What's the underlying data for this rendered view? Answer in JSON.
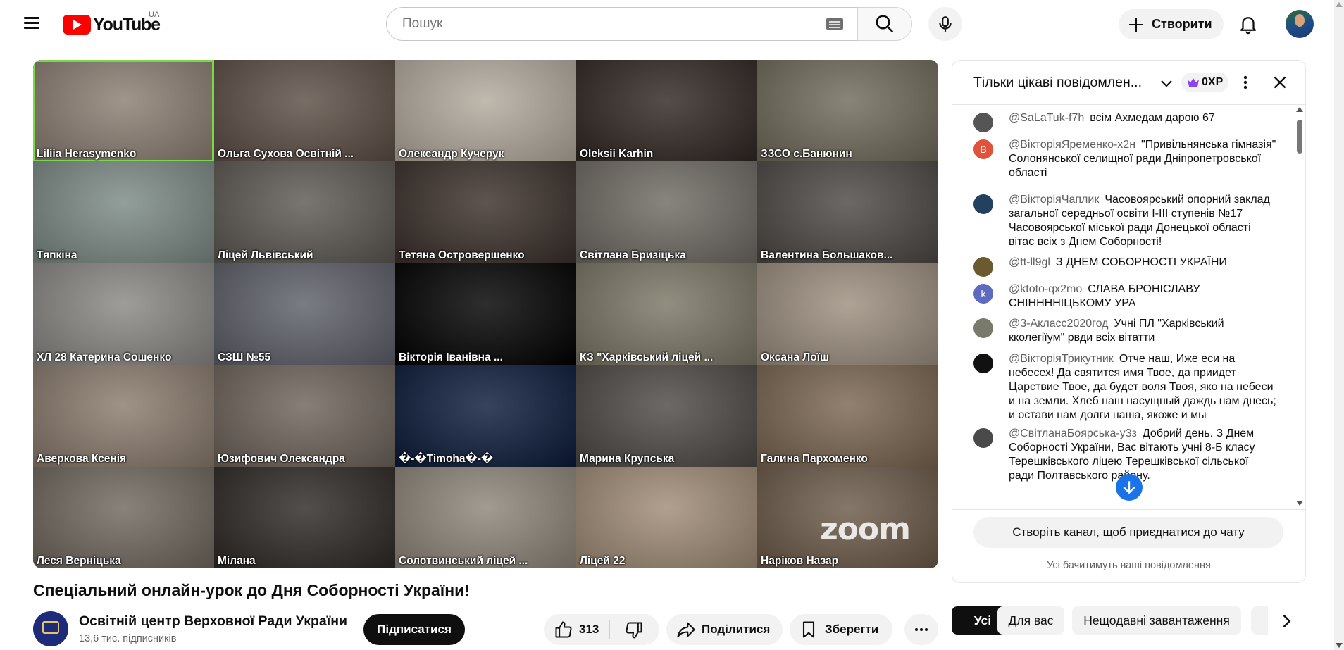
{
  "header": {
    "logo_text": "YouTube",
    "country_code": "UA",
    "search_placeholder": "Пошук",
    "create_label": "Створити"
  },
  "video": {
    "participants": [
      {
        "name": "Liliia Herasymenko",
        "bg": "#8b7e72",
        "active": true
      },
      {
        "name": "Ольга Сухова Освітній ...",
        "bg": "#5b4e45"
      },
      {
        "name": "Олександр Кучерук",
        "bg": "#b3aa9d"
      },
      {
        "name": "Oleksii Karhin",
        "bg": "#2f2622"
      },
      {
        "name": "ЗЗСО с.Банюнин",
        "bg": "#6f6a5a"
      },
      {
        "name": "Тяпкіна",
        "bg": "#7c8a86"
      },
      {
        "name": "Ліцей Львівський",
        "bg": "#5c5752"
      },
      {
        "name": "Тетяна Островершенко",
        "bg": "#3a2f2a"
      },
      {
        "name": "Світлана Бризіцька",
        "bg": "#6e6a63"
      },
      {
        "name": "Валентина Большаков...",
        "bg": "#4c4744"
      },
      {
        "name": "ХЛ 28 Катерина Сошенко",
        "bg": "#8a8784"
      },
      {
        "name": "СЗШ №55",
        "bg": "#5d5f68"
      },
      {
        "name": "Вікторія Іванівна ...",
        "bg": "#000000"
      },
      {
        "name": "КЗ \"Харківський ліцей ...",
        "bg": "#7a7564"
      },
      {
        "name": "Оксана Лоїш",
        "bg": "#9c8e7e"
      },
      {
        "name": "Аверкова Ксенія",
        "bg": "#8a7b6d"
      },
      {
        "name": "Юзифович Олександра",
        "bg": "#6d625a"
      },
      {
        "name": "�-�Timoha�-�",
        "bg": "#0b1a3a"
      },
      {
        "name": "Марина Крупська",
        "bg": "#4d4845"
      },
      {
        "name": "Галина Пархоменко",
        "bg": "#7a6550"
      },
      {
        "name": "Леся Верніцька",
        "bg": "#6f675e"
      },
      {
        "name": "Мілана",
        "bg": "#2d2824"
      },
      {
        "name": "Солотвинський ліцей ...",
        "bg": "#8e857a"
      },
      {
        "name": "Ліцей 22",
        "bg": "#a08b76"
      },
      {
        "name": "Наріков Назар",
        "bg": "#6b5a48"
      }
    ],
    "watermark": "zoom",
    "title": "Спеціальний онлайн-урок до Дня Соборності України!",
    "channel_name": "Освітній центр Верховної Ради України",
    "subscribers": "13,6 тис. підписників",
    "subscribe_label": "Підписатися",
    "like_count": "313",
    "share_label": "Поділитися",
    "save_label": "Зберегти"
  },
  "chat": {
    "title": "Тільки цікаві повідомлен...",
    "xp_label": "0XP",
    "accent_purple": "#8e44ec",
    "messages": [
      {
        "author": "@SaLaTuk-f7h",
        "text": "всім Ахмедам дарою 67",
        "avatar_color": "#555555",
        "avatar_letter": ""
      },
      {
        "author": "@ВікторіяЯременко-х2н",
        "text": "\"Привільнянська гімназія\" Солонянської селищної ради Дніпропетровської області",
        "avatar_color": "#e2523a",
        "avatar_letter": "В"
      },
      {
        "author": "@ВікторіяЧаплик",
        "text": "Часовоярський опорний заклад загальної середньої освіти І-ІІІ ступенів №17 Часовоярської міської ради Донецької області вітає всіх з Днем Соборності!",
        "avatar_color": "#23415e",
        "avatar_letter": ""
      },
      {
        "author": "@tt-ll9gl",
        "text": "З ДНЕМ СОБОРНОСТІ УКРАЇНИ",
        "avatar_color": "#6b5a2e",
        "avatar_letter": ""
      },
      {
        "author": "@ktoto-qx2mo",
        "text": "СЛАВА БРОНІСЛАВУ СНІННННІЦЬКОМУ УРА",
        "avatar_color": "#5c6bc0",
        "avatar_letter": "k"
      },
      {
        "author": "@3-Акласс2020год",
        "text": "Учні ПЛ \"Харківський кколегіїум\" рвди всіх вітатти",
        "avatar_color": "#7a7a6a",
        "avatar_letter": ""
      },
      {
        "author": "@ВікторіяТрикутник",
        "text": "Отче наш, Иже еси на небесех! Да святится имя Твое, да приидет Царствие Твое, да будет воля Твоя, яко на небеси и на земли. Хлеб наш насущный даждь нам днесь; и остави нам долги наша, якоже и мы",
        "avatar_color": "#111111",
        "avatar_letter": ""
      },
      {
        "author": "@СвітланаБоярська-у3з",
        "text": "Добрий день. З Днем Соборності України, Вас вітають учні 8-Б класу Терешківського ліцею Терешківської сільської ради Полтавського району.",
        "avatar_color": "#4a4a4a",
        "avatar_letter": ""
      }
    ],
    "join_label": "Створіть канал, щоб приєднатися до чату",
    "footer_note": "Усі бачитимуть ваші повідомлення"
  },
  "chips": [
    {
      "label": "Усі",
      "selected": true
    },
    {
      "label": "Для вас",
      "selected": false
    },
    {
      "label": "Нещодавні завантаження",
      "selected": false
    }
  ]
}
